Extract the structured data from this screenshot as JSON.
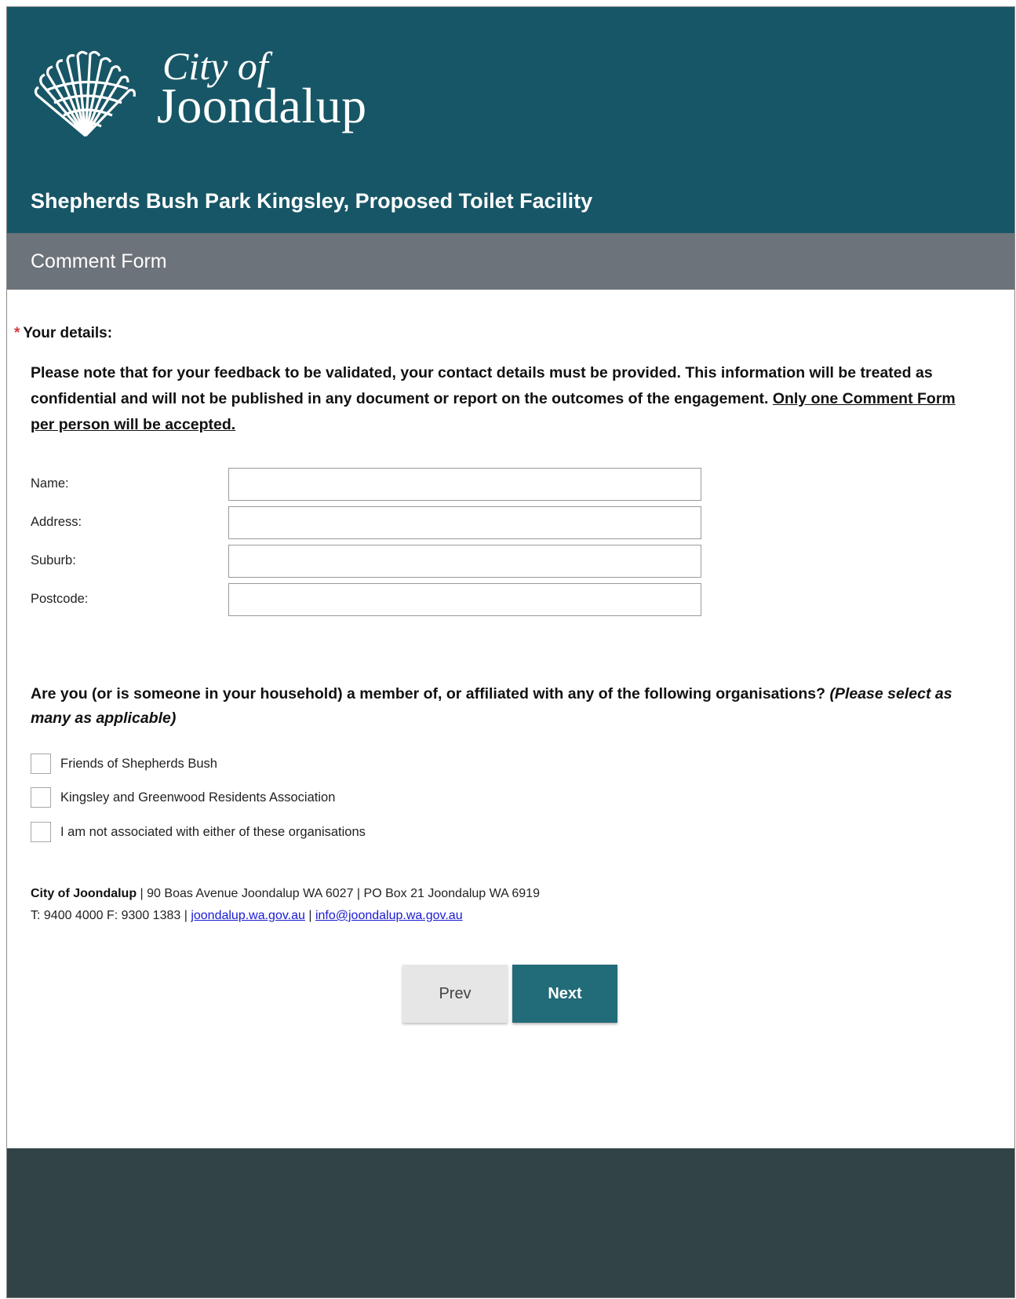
{
  "header": {
    "logo_line1": "City of",
    "logo_line2": "Joondalup",
    "page_heading": "Shepherds Bush Park Kingsley, Proposed Toilet Facility",
    "background_color": "#175666"
  },
  "subheader": {
    "title": "Comment Form",
    "background_color": "#6d737a"
  },
  "details": {
    "required_marker": "*",
    "heading": "Your details:",
    "notice": "Please note that for your feedback to be validated, your contact details must be provided. This information will be treated as confidential and will not be published in any document or report on the outcomes of the engagement. ",
    "notice_underlined": "Only one Comment Form per person will be accepted."
  },
  "fields": [
    {
      "label": "Name:",
      "value": ""
    },
    {
      "label": "Address:",
      "value": ""
    },
    {
      "label": "Suburb:",
      "value": ""
    },
    {
      "label": "Postcode:",
      "value": ""
    }
  ],
  "affiliation": {
    "question": "Are you (or is someone in your household) a member of, or affiliated with any of the following organisations? ",
    "hint": "(Please select as many as applicable)",
    "options": [
      {
        "label": "Friends of Shepherds Bush",
        "checked": false
      },
      {
        "label": "Kingsley and Greenwood Residents Association",
        "checked": false
      },
      {
        "label": "I am not associated with either of these organisations",
        "checked": false
      }
    ]
  },
  "contact": {
    "org": "City of Joondalup",
    "line1_rest": " | 90 Boas Avenue Joondalup WA 6027 | PO Box 21 Joondalup WA 6919",
    "line2_prefix": "T: 9400 4000 F: 9300 1383 | ",
    "website": "joondalup.wa.gov.au",
    "separator": " | ",
    "email": "info@joondalup.wa.gov.au"
  },
  "nav": {
    "prev_label": "Prev",
    "next_label": "Next",
    "next_color": "#226b78"
  },
  "footer": {
    "background_color": "#324345"
  }
}
